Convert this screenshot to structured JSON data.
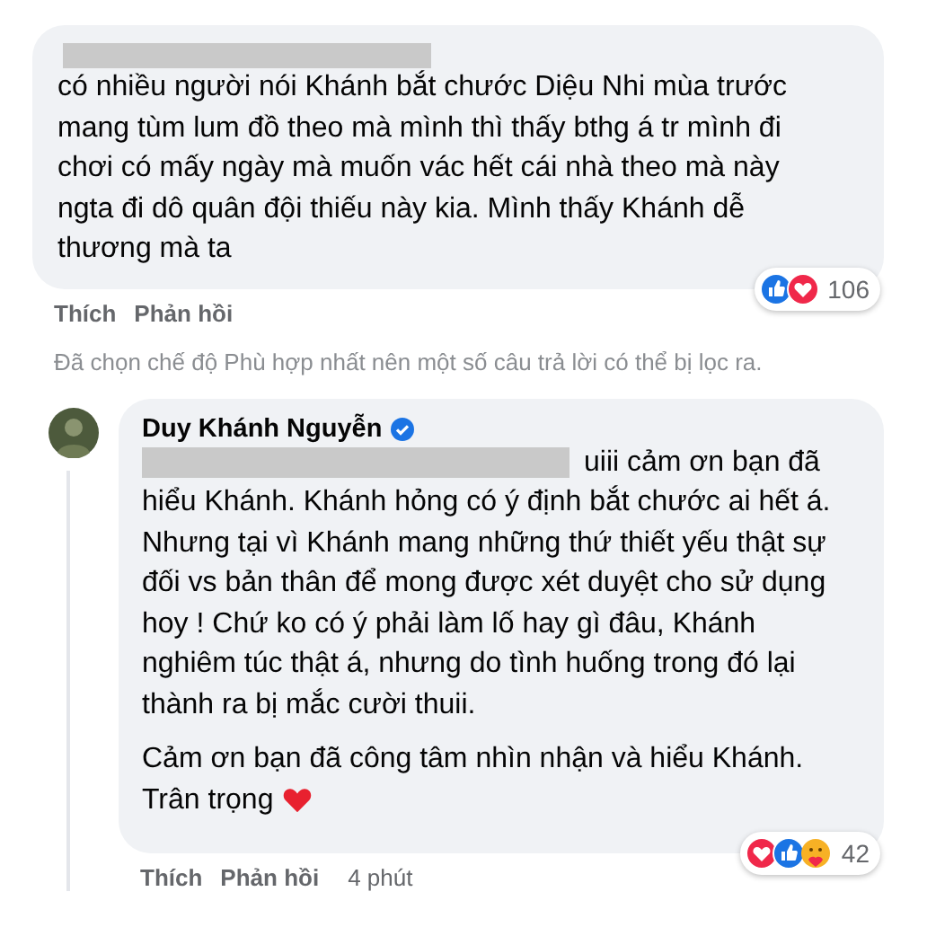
{
  "comment": {
    "text": "có nhiều người nói Khánh bắt chước Diệu Nhi mùa trước mang tùm lum đồ theo mà mình thì thấy bthg á tr mình đi chơi có mấy ngày mà muốn vác hết cái nhà theo mà này ngta đi dô quân đội thiếu này kia. Mình thấy Khánh dễ thương mà ta",
    "reactions": [
      {
        "kind": "like"
      },
      {
        "kind": "love"
      }
    ],
    "reaction_count": "106",
    "actions": [
      "Thích",
      "Phản hồi"
    ]
  },
  "filter_notice": "Đã chọn chế độ Phù hợp nhất nên một số câu trả lời có thể bị lọc ra.",
  "reply": {
    "author": "Duy Khánh Nguyễn",
    "verified": true,
    "paragraphs": [
      {
        "kind": "after_redaction",
        "first_line": "uiii cảm ơn bạn đã",
        "rest": "hiểu Khánh. Khánh hỏng có ý định bắt chước ai hết á. Nhưng tại vì Khánh mang những thứ thiết yếu thật sự đối vs bản thân để mong được xét duyệt cho sử dụng hoy ! Chứ ko có ý phải làm lố hay gì đâu, Khánh nghiêm túc thật á, nhưng do tình huống trong đó lại thành ra bị mắc cười thuii."
      },
      {
        "kind": "closing_with_heart",
        "first_line": "Cảm ơn bạn đã công tâm nhìn nhận và hiểu Khánh.",
        "rest": "Trân trọng"
      }
    ],
    "reactions": [
      {
        "kind": "love"
      },
      {
        "kind": "like"
      },
      {
        "kind": "care"
      }
    ],
    "reaction_count": "42",
    "actions": [
      "Thích",
      "Phản hồi"
    ],
    "time": "4 phút"
  }
}
